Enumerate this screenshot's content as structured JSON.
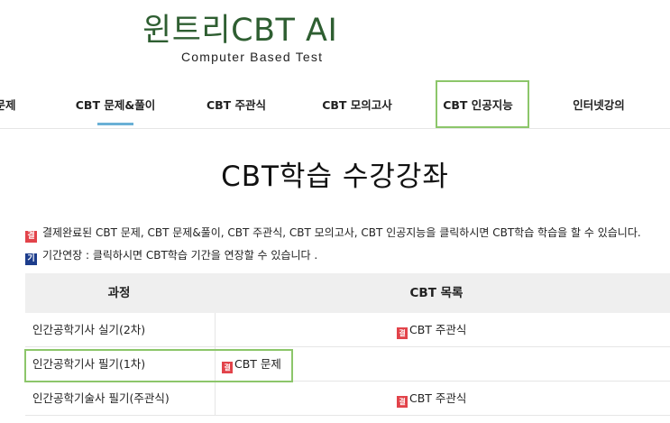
{
  "logo": {
    "title": "윈트리CBT AI",
    "subtitle": "Computer Based Test"
  },
  "nav": {
    "items": [
      {
        "label": "문제"
      },
      {
        "label": "CBT 문제&풀이"
      },
      {
        "label": "CBT 주관식"
      },
      {
        "label": "CBT 모의고사"
      },
      {
        "label": "CBT 인공지능"
      },
      {
        "label": "인터넷강의"
      }
    ],
    "active": "CBT 문제&풀이",
    "highlighted": "CBT 인공지능"
  },
  "page": {
    "title": "CBT학습 수강강좌"
  },
  "notes": [
    {
      "badge": "결",
      "badge_color": "#e2434a",
      "text": "결제완료된 CBT 문제, CBT 문제&풀이, CBT 주관식, CBT 모의고사, CBT 인공지능을 클릭하시면 CBT학습 학습을 할 수 있습니다."
    },
    {
      "badge": "기",
      "badge_color": "#1d3d8c",
      "text": "기간연장 : 클릭하시면 CBT학습 기간을 연장할 수 있습니다 ."
    }
  ],
  "table": {
    "headers": {
      "course": "과정",
      "list": "CBT 목록"
    },
    "rows": [
      {
        "course": "인간공학기사 실기(2차)",
        "badge": "결",
        "link": "CBT 주관식"
      },
      {
        "course": "인간공학기사 필기(1차)",
        "badge": "결",
        "link": "CBT 문제"
      },
      {
        "course": "인간공학기술사 필기(주관식)",
        "badge": "결",
        "link": "CBT 주관식"
      }
    ]
  },
  "colors": {
    "brand_green": "#2e5e31",
    "highlight_green": "#8cc66a",
    "active_underline": "#6ab0d6",
    "badge_red": "#e2434a",
    "badge_blue": "#1d3d8c"
  }
}
